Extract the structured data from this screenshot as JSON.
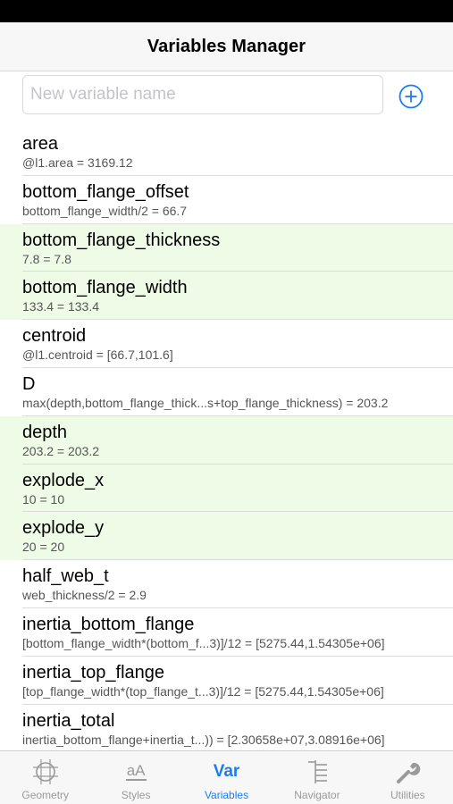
{
  "nav": {
    "title": "Variables Manager"
  },
  "add": {
    "placeholder": "New variable name"
  },
  "variables": [
    {
      "name": "area",
      "expression": "@l1.area = 3169.12",
      "defined": false
    },
    {
      "name": "bottom_flange_offset",
      "expression": "bottom_flange_width/2 = 66.7",
      "defined": false
    },
    {
      "name": "bottom_flange_thickness",
      "expression": "7.8 = 7.8",
      "defined": true
    },
    {
      "name": "bottom_flange_width",
      "expression": "133.4 = 133.4",
      "defined": true
    },
    {
      "name": "centroid",
      "expression": "@l1.centroid = [66.7,101.6]",
      "defined": false
    },
    {
      "name": "D",
      "expression": "max(depth,bottom_flange_thick...s+top_flange_thickness) = 203.2",
      "defined": false
    },
    {
      "name": "depth",
      "expression": "203.2 = 203.2",
      "defined": true
    },
    {
      "name": "explode_x",
      "expression": "10 = 10",
      "defined": true
    },
    {
      "name": "explode_y",
      "expression": "20 = 20",
      "defined": true
    },
    {
      "name": "half_web_t",
      "expression": "web_thickness/2 = 2.9",
      "defined": false
    },
    {
      "name": "inertia_bottom_flange",
      "expression": "[bottom_flange_width*(bottom_f...3)]/12 = [5275.44,1.54305e+06]",
      "defined": false
    },
    {
      "name": "inertia_top_flange",
      "expression": "[top_flange_width*(top_flange_t...3)]/12 = [5275.44,1.54305e+06]",
      "defined": false
    },
    {
      "name": "inertia_total",
      "expression": "inertia_bottom_flange+inertia_t...)) = [2.30658e+07,3.08916e+06]",
      "defined": false
    }
  ],
  "tabs": [
    {
      "label": "Geometry",
      "icon": "geometry-grid-icon",
      "active": false
    },
    {
      "label": "Styles",
      "icon": "styles-icon",
      "glyph": "aA",
      "active": false
    },
    {
      "label": "Variables",
      "icon": "variables-icon",
      "glyph": "Var",
      "active": true
    },
    {
      "label": "Navigator",
      "icon": "navigator-icon",
      "active": false
    },
    {
      "label": "Utilities",
      "icon": "wrench-icon",
      "active": false
    }
  ],
  "colors": {
    "accent": "#1a7df0",
    "defined_row": "#eefbe7",
    "inactive": "#9a9a9a"
  }
}
